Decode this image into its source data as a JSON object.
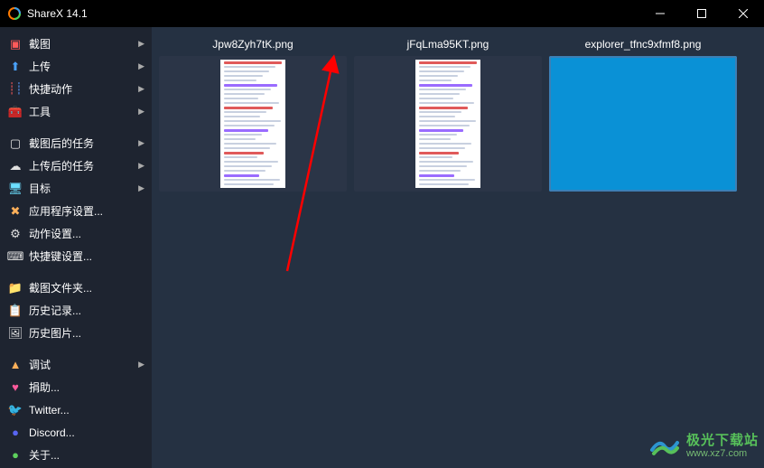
{
  "window": {
    "title": "ShareX 14.1"
  },
  "sidebar": {
    "groups": [
      [
        {
          "icon": "capture-icon",
          "iconClass": "ic-red",
          "glyph": "▣",
          "label": "截图",
          "hasArrow": true
        },
        {
          "icon": "upload-icon",
          "iconClass": "ic-blue",
          "glyph": "⬆",
          "label": "上传",
          "hasArrow": true
        },
        {
          "icon": "quick-actions-icon",
          "iconClass": "ic-rgb",
          "glyph": "┊┊",
          "label": "快捷动作",
          "hasArrow": true
        },
        {
          "icon": "tools-icon",
          "iconClass": "ic-red",
          "glyph": "🧰",
          "label": "工具",
          "hasArrow": true
        }
      ],
      [
        {
          "icon": "after-capture-icon",
          "iconClass": "ic-white",
          "glyph": "▢",
          "label": "截图后的任务",
          "hasArrow": true
        },
        {
          "icon": "after-upload-icon",
          "iconClass": "ic-white",
          "glyph": "☁",
          "label": "上传后的任务",
          "hasArrow": true
        },
        {
          "icon": "destinations-icon",
          "iconClass": "ic-cyan",
          "glyph": "🖥",
          "label": "目标",
          "hasArrow": true
        },
        {
          "icon": "app-settings-icon",
          "iconClass": "ic-orange",
          "glyph": "✖",
          "label": "应用程序设置...",
          "hasArrow": false
        },
        {
          "icon": "task-settings-icon",
          "iconClass": "ic-white",
          "glyph": "⚙",
          "label": "动作设置...",
          "hasArrow": false
        },
        {
          "icon": "hotkey-settings-icon",
          "iconClass": "ic-white",
          "glyph": "⌨",
          "label": "快捷键设置...",
          "hasArrow": false
        }
      ],
      [
        {
          "icon": "folder-icon",
          "iconClass": "ic-yellow",
          "glyph": "📁",
          "label": "截图文件夹...",
          "hasArrow": false
        },
        {
          "icon": "history-icon",
          "iconClass": "ic-white",
          "glyph": "📋",
          "label": "历史记录...",
          "hasArrow": false
        },
        {
          "icon": "image-history-icon",
          "iconClass": "ic-white",
          "glyph": "🖼",
          "label": "历史图片...",
          "hasArrow": false
        }
      ],
      [
        {
          "icon": "debug-icon",
          "iconClass": "ic-orange",
          "glyph": "▲",
          "label": "调试",
          "hasArrow": true
        },
        {
          "icon": "donate-icon",
          "iconClass": "ic-pink",
          "glyph": "♥",
          "label": "捐助...",
          "hasArrow": false
        },
        {
          "icon": "twitter-icon",
          "iconClass": "ic-blue",
          "glyph": "🐦",
          "label": "Twitter...",
          "hasArrow": false
        },
        {
          "icon": "discord-icon",
          "iconClass": "ic-discord",
          "glyph": "●",
          "label": "Discord...",
          "hasArrow": false
        },
        {
          "icon": "about-icon",
          "iconClass": "ic-green",
          "glyph": "●",
          "label": "关于...",
          "hasArrow": false
        }
      ]
    ]
  },
  "thumbs": [
    {
      "name": "Jpw8Zyh7tK.png",
      "type": "page",
      "selected": false
    },
    {
      "name": "jFqLma95KT.png",
      "type": "page",
      "selected": false
    },
    {
      "name": "explorer_tfnc9xfmf8.png",
      "type": "bluesolid",
      "selected": true
    }
  ],
  "watermark": {
    "cn": "极光下载站",
    "url": "www.xz7.com"
  }
}
